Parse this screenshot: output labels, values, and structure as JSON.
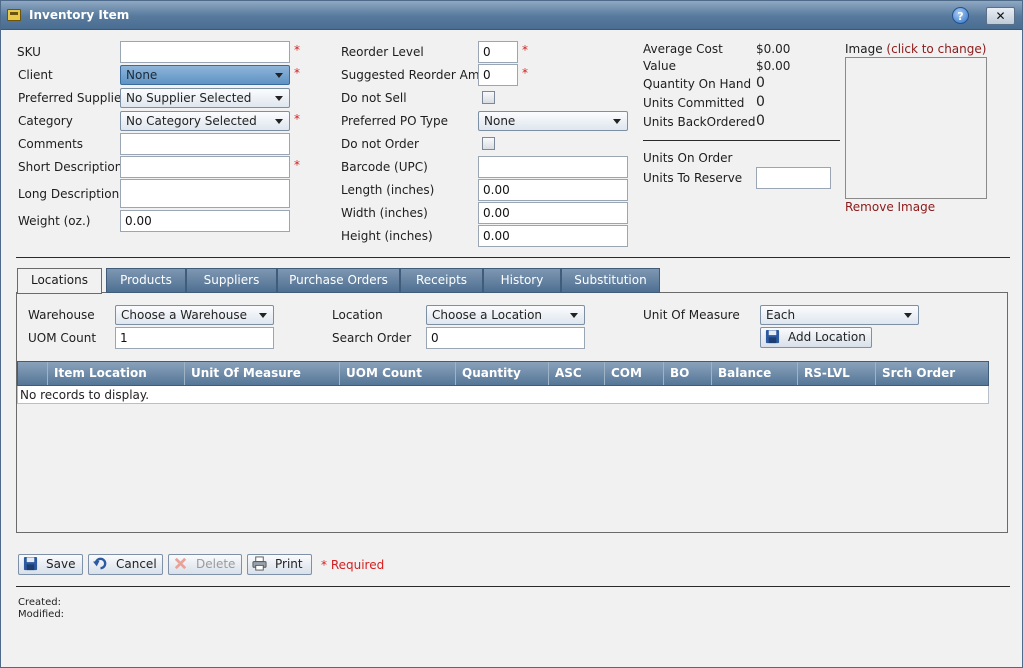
{
  "window": {
    "title": "Inventory Item",
    "help": "?",
    "close": "✕"
  },
  "left": {
    "sku_label": "SKU",
    "sku_value": "",
    "client_label": "Client",
    "client_value": "None",
    "supplier_label": "Preferred Supplier",
    "supplier_value": "No Supplier Selected",
    "category_label": "Category",
    "category_value": "No Category Selected",
    "comments_label": "Comments",
    "comments_value": "",
    "short_desc_label": "Short Description",
    "short_desc_value": "",
    "long_desc_label": "Long Description",
    "long_desc_value": "",
    "weight_label": "Weight (oz.)",
    "weight_value": "0.00"
  },
  "middle": {
    "reorder_level_label": "Reorder Level",
    "reorder_level_value": "0",
    "suggested_label": "Suggested Reorder Amt",
    "suggested_value": "0",
    "do_not_sell_label": "Do not Sell",
    "po_type_label": "Preferred PO Type",
    "po_type_value": "None",
    "do_not_order_label": "Do not Order",
    "barcode_label": "Barcode (UPC)",
    "barcode_value": "",
    "length_label": "Length (inches)",
    "length_value": "0.00",
    "width_label": "Width (inches)",
    "width_value": "0.00",
    "height_label": "Height (inches)",
    "height_value": "0.00"
  },
  "stats": {
    "avg_cost_label": "Average Cost",
    "avg_cost_value": "$0.00",
    "value_label": "Value",
    "value_value": "$0.00",
    "qoh_label": "Quantity On Hand",
    "qoh_value": "0",
    "committed_label": "Units Committed",
    "committed_value": "0",
    "backordered_label": "Units BackOrdered",
    "backordered_value": "0",
    "on_order_label": "Units On Order",
    "to_reserve_label": "Units To Reserve",
    "to_reserve_value": ""
  },
  "image": {
    "label": "Image",
    "hint": "(click to change)",
    "remove": "Remove Image"
  },
  "tabs": [
    "Locations",
    "Products",
    "Suppliers",
    "Purchase Orders",
    "Receipts",
    "History",
    "Substitution"
  ],
  "locations": {
    "warehouse_label": "Warehouse",
    "warehouse_value": "Choose a Warehouse",
    "uom_count_label": "UOM Count",
    "uom_count_value": "1",
    "location_label": "Location",
    "location_value": "Choose a Location",
    "search_order_label": "Search Order",
    "search_order_value": "0",
    "uom_label": "Unit Of Measure",
    "uom_value": "Each",
    "add_button": "Add Location"
  },
  "grid": {
    "columns": [
      "Item Location",
      "Unit Of Measure",
      "UOM Count",
      "Quantity",
      "ASC",
      "COM",
      "BO",
      "Balance",
      "RS-LVL",
      "Srch Order"
    ],
    "empty": "No records to display."
  },
  "actions": {
    "save": "Save",
    "cancel": "Cancel",
    "delete": "Delete",
    "print": "Print",
    "required_note": "* Required"
  },
  "footer": {
    "created": "Created:",
    "modified": "Modified:"
  },
  "colors": {
    "required": "#d42020",
    "link": "#8b1a1a",
    "header": "#557697"
  }
}
